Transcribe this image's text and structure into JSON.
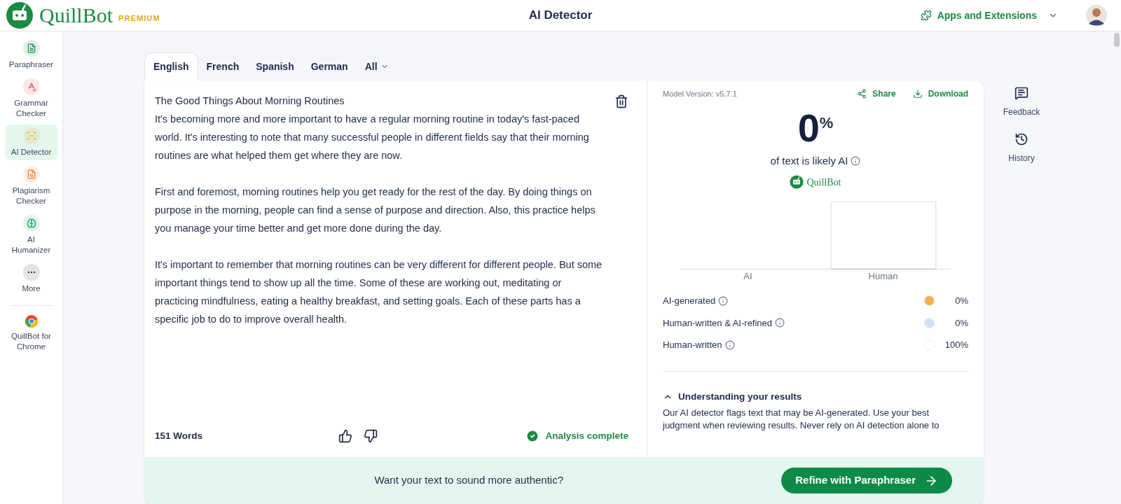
{
  "header": {
    "logo": "QuillBot",
    "badge": "PREMIUM",
    "title": "AI Detector",
    "apps_menu": "Apps and Extensions"
  },
  "sidebar": {
    "items": [
      {
        "label": "Paraphraser",
        "selected": false
      },
      {
        "label": "Grammar Checker",
        "selected": false
      },
      {
        "label": "AI Detector",
        "selected": true
      },
      {
        "label": "Plagiarism Checker",
        "selected": false
      },
      {
        "label": "AI Humanizer",
        "selected": false
      },
      {
        "label": "More",
        "selected": false
      }
    ],
    "extension": "QuillBot for Chrome"
  },
  "tabs": [
    {
      "label": "English",
      "selected": true
    },
    {
      "label": "French",
      "selected": false
    },
    {
      "label": "Spanish",
      "selected": false
    },
    {
      "label": "German",
      "selected": false
    },
    {
      "label": "All",
      "selected": false
    }
  ],
  "editor": {
    "paragraphs": [
      "The Good Things About Morning Routines\nIt's becoming more and more important to have a regular morning routine in today's fast-paced world. It's interesting to note that many successful people in different fields say that their morning routines are what helped them get where they are now.",
      "First and foremost, morning routines help you get ready for the rest of the day. By doing things on purpose in the morning, people can find a sense of purpose and direction. Also, this practice helps you manage your time better and get more done during the day.",
      "It's important to remember that morning routines can be very different for different people. But some important things tend to show up all the time. Some of these are working out, meditating or practicing mindfulness, eating a healthy breakfast, and setting goals. Each of these parts has a specific job to do to improve overall health."
    ],
    "word_count": "151 Words",
    "status": "Analysis complete"
  },
  "results": {
    "model_version": "Model Version: v5.7.1",
    "share": "Share",
    "download": "Download",
    "score": "0",
    "score_unit": "%",
    "score_caption": "of text is likely AI",
    "brand": "QuillBot",
    "bar_labels": [
      "AI",
      "Human"
    ],
    "legend": [
      {
        "label": "AI-generated",
        "color": "#f8ad4e",
        "value": "0%"
      },
      {
        "label": "Human-written & AI-refined",
        "color": "#cfe0fa",
        "value": "0%"
      },
      {
        "label": "Human-written",
        "color": "#ffffff",
        "value": "100%"
      }
    ],
    "understanding": {
      "title": "Understanding your results",
      "expanded": true,
      "text": "Our AI detector flags text that may be AI-generated. Use your best judgment when reviewing results. Never rely on AI detection alone to"
    }
  },
  "banner": {
    "prompt": "Want your text to sound more authentic?",
    "button": "Refine with Paraphraser"
  },
  "side_actions": [
    {
      "label": "Feedback",
      "kind": "feedback"
    },
    {
      "label": "History",
      "kind": "history"
    }
  ]
}
